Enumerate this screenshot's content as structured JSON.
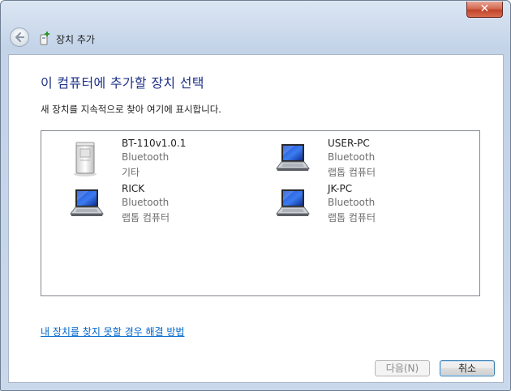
{
  "window": {
    "title": "장치 추가",
    "close_symbol": "✕"
  },
  "main": {
    "heading": "이 컴퓨터에 추가할 장치 선택",
    "subtext": "새 장치를 지속적으로 찾아 여기에 표시합니다.",
    "devices": [
      {
        "name": "BT-110v1.0.1",
        "type": "Bluetooth",
        "category": "기타",
        "icon": "generic-device-icon"
      },
      {
        "name": "USER-PC",
        "type": "Bluetooth",
        "category": "랩톱 컴퓨터",
        "icon": "laptop-icon"
      },
      {
        "name": "RICK",
        "type": "Bluetooth",
        "category": "랩톱 컴퓨터",
        "icon": "laptop-icon"
      },
      {
        "name": "JK-PC",
        "type": "Bluetooth",
        "category": "랩톱 컴퓨터",
        "icon": "laptop-icon"
      }
    ],
    "help_link": "내 장치를 찾지 못할 경우 해결 방법"
  },
  "footer": {
    "next_label": "다음(N)",
    "cancel_label": "취소"
  },
  "colors": {
    "heading": "#1e3287",
    "link": "#0066cc",
    "close_button": "#c0432a"
  }
}
